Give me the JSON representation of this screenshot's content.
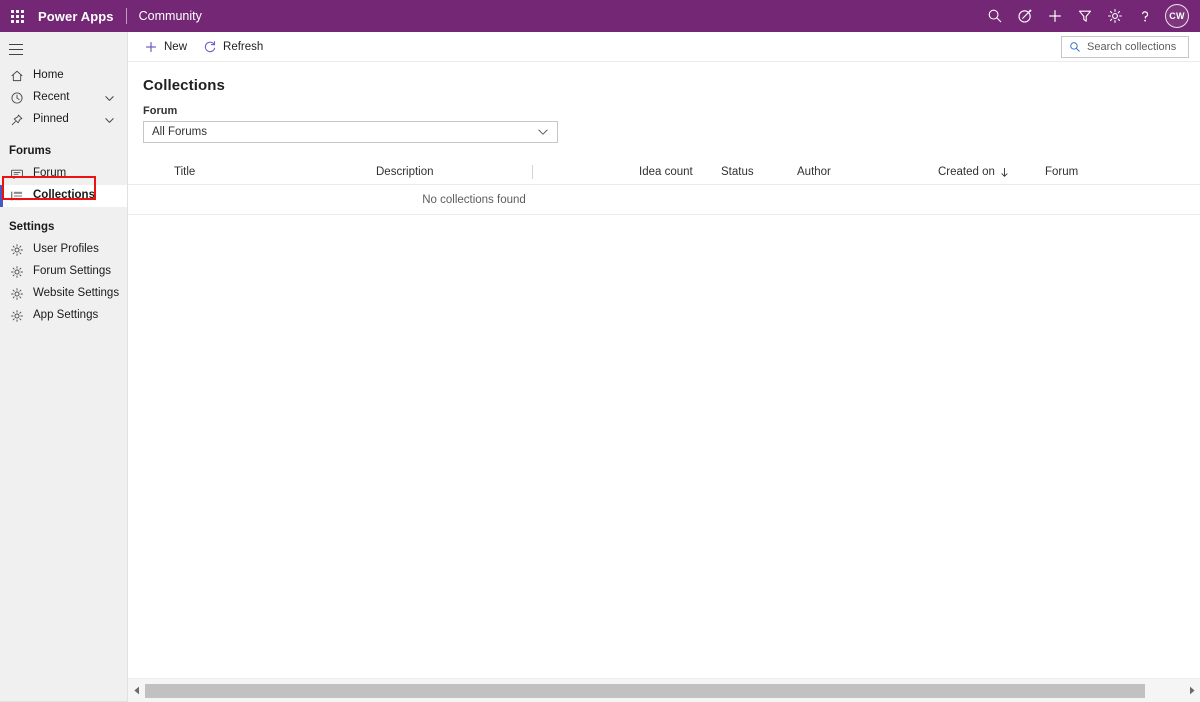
{
  "header": {
    "waffle_icon": "app-launcher-icon",
    "brand": "Power Apps",
    "app_name": "Community",
    "actions": [
      {
        "name": "search-icon",
        "label": "Search"
      },
      {
        "name": "environment-icon",
        "label": "Environment"
      },
      {
        "name": "plus-icon",
        "label": "New"
      },
      {
        "name": "filter-icon",
        "label": "Filter"
      },
      {
        "name": "gear-icon",
        "label": "Settings"
      },
      {
        "name": "help-icon",
        "label": "Help"
      }
    ],
    "avatar_initials": "CW",
    "background_color": "#742774"
  },
  "sidebar": {
    "hamburger_label": "Collapse navigation",
    "items": [
      {
        "label": "Home",
        "icon": "home-icon",
        "expandable": false,
        "selected": false
      },
      {
        "label": "Recent",
        "icon": "clock-icon",
        "expandable": true,
        "selected": false
      },
      {
        "label": "Pinned",
        "icon": "pin-icon",
        "expandable": true,
        "selected": false
      }
    ],
    "groups": [
      {
        "title": "Forums",
        "items": [
          {
            "label": "Forum",
            "icon": "forum-icon",
            "selected": false
          },
          {
            "label": "Collections",
            "icon": "collections-list-icon",
            "selected": true
          }
        ]
      },
      {
        "title": "Settings",
        "items": [
          {
            "label": "User Profiles",
            "icon": "gear-icon",
            "selected": false
          },
          {
            "label": "Forum Settings",
            "icon": "gear-icon",
            "selected": false
          },
          {
            "label": "Website Settings",
            "icon": "gear-icon",
            "selected": false
          },
          {
            "label": "App Settings",
            "icon": "gear-icon",
            "selected": false
          }
        ]
      }
    ],
    "selected_accent_color": "#4659c4",
    "background_color": "#f0f0f0"
  },
  "annotation": {
    "color": "#ee1111",
    "target": "Collections"
  },
  "command_bar": {
    "new_label": "New",
    "refresh_label": "Refresh",
    "search_placeholder": "Search collections",
    "search_value": ""
  },
  "main": {
    "title": "Collections",
    "filter": {
      "label": "Forum",
      "value": "All Forums"
    },
    "grid": {
      "columns": [
        {
          "label": "Title",
          "sorted": false
        },
        {
          "label": "Description",
          "sorted": false
        },
        {
          "label": "Idea count",
          "sorted": false
        },
        {
          "label": "Status",
          "sorted": false
        },
        {
          "label": "Author",
          "sorted": false
        },
        {
          "label": "Created on",
          "sorted": true,
          "sort_direction": "desc"
        },
        {
          "label": "Forum",
          "sorted": false
        }
      ],
      "rows": [],
      "empty_message": "No collections found"
    }
  },
  "scrollbar": {
    "left_arrow": "chevron-left-icon",
    "right_arrow": "chevron-right-icon",
    "thumb_position": 0
  }
}
